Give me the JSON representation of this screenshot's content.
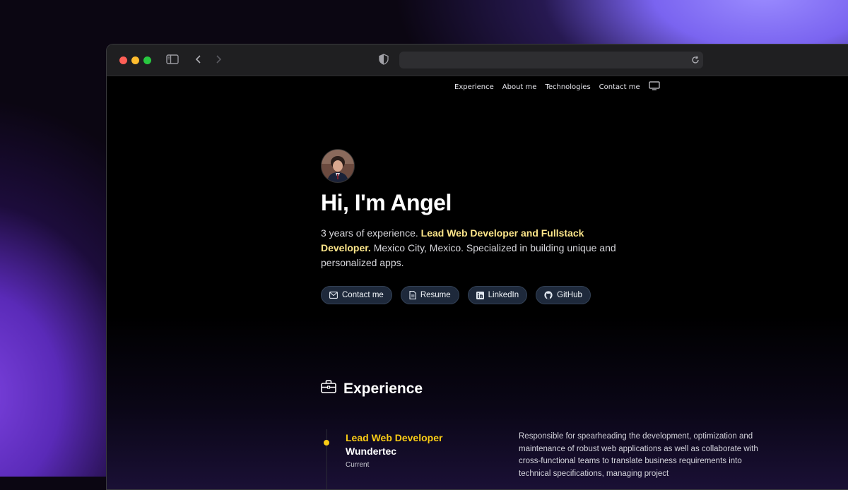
{
  "browser": {
    "address_value": ""
  },
  "nav": {
    "items": [
      "Experience",
      "About me",
      "Technologies",
      "Contact me"
    ],
    "theme_icon": "monitor-icon"
  },
  "hero": {
    "title": "Hi, I'm Angel",
    "intro_prefix": "3 years of experience.",
    "intro_highlight": "Lead Web Developer and Fullstack Developer.",
    "intro_suffix": "Mexico City, Mexico. Specialized in building unique and personalized apps.",
    "buttons": [
      {
        "label": "Contact me",
        "icon": "mail-icon"
      },
      {
        "label": "Resume",
        "icon": "document-icon"
      },
      {
        "label": "LinkedIn",
        "icon": "linkedin-icon"
      },
      {
        "label": "GitHub",
        "icon": "github-icon"
      }
    ]
  },
  "experience": {
    "title": "Experience",
    "icon": "briefcase-icon",
    "jobs": [
      {
        "role": "Lead Web Developer",
        "company": "Wundertec",
        "period": "Current",
        "description": "Responsible for spearheading the development, optimization and maintenance of robust web applications as well as collaborate with cross-functional teams to translate business requirements into technical specifications, managing project"
      }
    ]
  },
  "colors": {
    "accent_yellow": "#facc15",
    "highlight_yellow": "#fde68a",
    "button_bg": "#1e293b"
  }
}
